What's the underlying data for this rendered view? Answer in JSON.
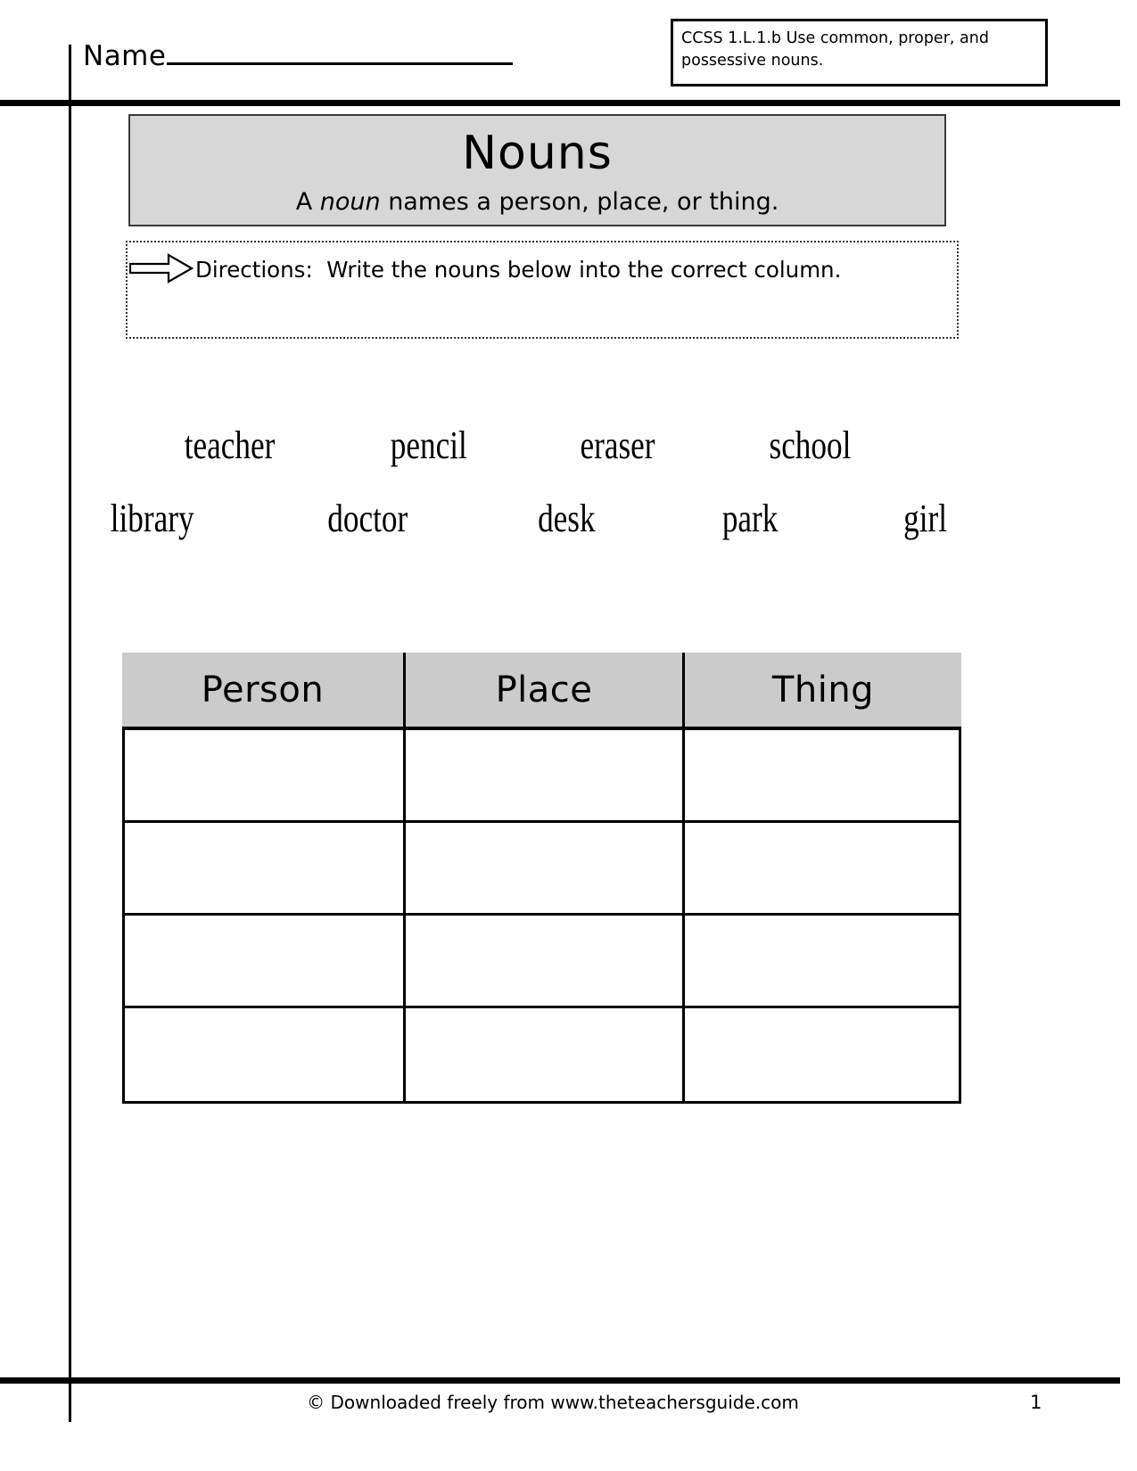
{
  "page": {
    "name_label": "Name",
    "footer_credit": "© Downloaded freely from www.theteachersguide.com",
    "page_number": "1"
  },
  "ccss": {
    "line1": "CCSS 1.L.1.b Use common, proper, and",
    "line2": "possessive nouns."
  },
  "banner": {
    "title": "Nouns",
    "subtitle_before": "A ",
    "subtitle_emphasis": "noun",
    "subtitle_after": " names a person, place, or thing."
  },
  "directions": {
    "icon": "right-arrow-icon",
    "text": "Directions:  Write the nouns below into the correct column."
  },
  "word_bank": {
    "row1": [
      "teacher",
      "pencil",
      "eraser",
      "school"
    ],
    "row2": [
      "library",
      "doctor",
      "desk",
      "park",
      "girl"
    ]
  },
  "sort_table": {
    "headers": [
      "Person",
      "Place",
      "Thing"
    ],
    "rows": [
      [
        "",
        "",
        ""
      ],
      [
        "",
        "",
        ""
      ],
      [
        "",
        "",
        ""
      ],
      [
        "",
        "",
        ""
      ]
    ]
  },
  "colors": {
    "banner_fill": "#d7d7d7",
    "table_header_fill": "#cbcbcb",
    "rule": "#000000"
  }
}
